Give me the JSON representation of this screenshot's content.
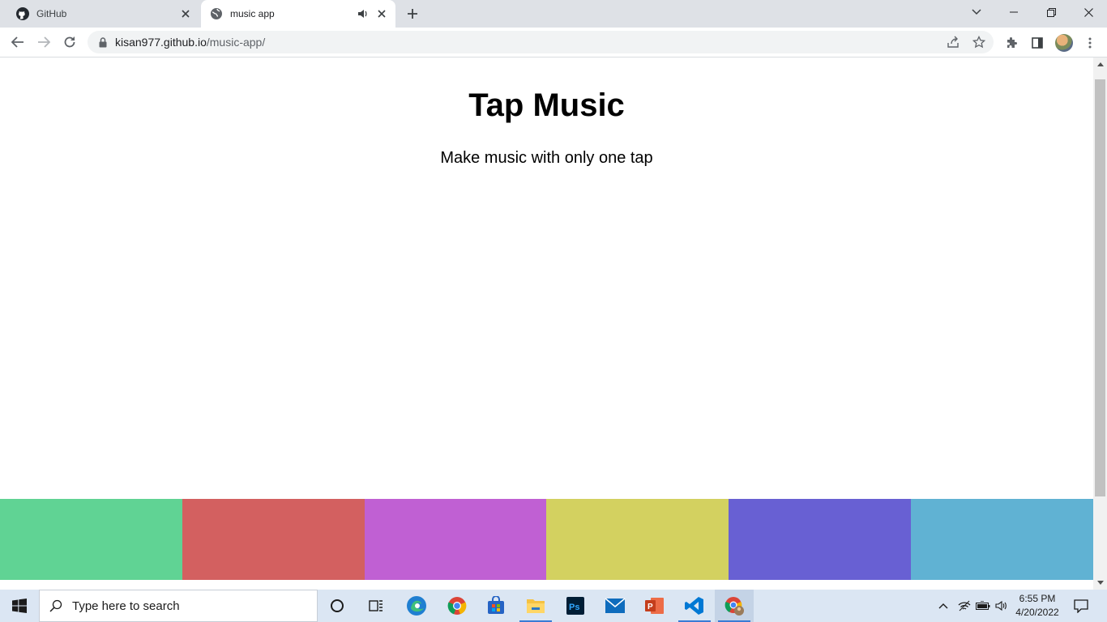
{
  "browser": {
    "tabs": [
      {
        "title": "GitHub",
        "icon": "github-icon",
        "active": false
      },
      {
        "title": "music app",
        "icon": "globe-icon",
        "active": true,
        "playing_audio": true
      }
    ],
    "address": {
      "host": "kisan977.github.io",
      "path": "/music-app/"
    }
  },
  "page": {
    "title": "Tap Music",
    "subtitle": "Make music with only one tap",
    "pads": [
      {
        "name": "pad-1",
        "color": "#60d394"
      },
      {
        "name": "pad-2",
        "color": "#d36060"
      },
      {
        "name": "pad-3",
        "color": "#c060d3"
      },
      {
        "name": "pad-4",
        "color": "#d3d160"
      },
      {
        "name": "pad-5",
        "color": "#6860d3"
      },
      {
        "name": "pad-6",
        "color": "#60b2d3"
      }
    ]
  },
  "taskbar": {
    "search_placeholder": "Type here to search",
    "apps": [
      "cortana-icon",
      "task-view-icon",
      "edge-icon",
      "chrome-icon",
      "store-icon",
      "file-explorer-icon",
      "photoshop-icon",
      "mail-icon",
      "powerpoint-icon",
      "vscode-icon",
      "chrome-profile-icon"
    ],
    "time": "6:55 PM",
    "date": "4/20/2022"
  },
  "colors": {
    "tabstrip": "#dee1e6",
    "taskbar": "#dbe6f3",
    "accent": "#3a7bd5"
  }
}
